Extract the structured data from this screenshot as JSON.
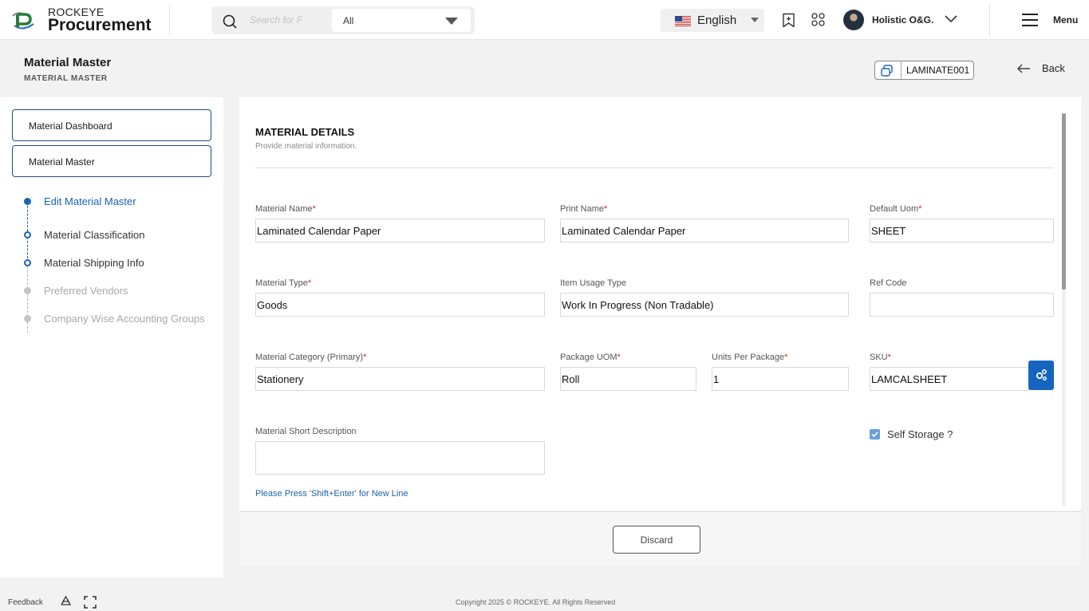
{
  "header": {
    "brand_top": "ROCKEYE",
    "brand_main": "Procurement",
    "search_placeholder": "Search for F",
    "scope_value": "All",
    "language": "English",
    "user_name": "Holistic O&G.",
    "menu_label": "Menu"
  },
  "page": {
    "title": "Material Master",
    "subtitle": "MATERIAL MASTER",
    "code": "LAMINATE001",
    "back_label": "Back"
  },
  "sidebar": {
    "buttons": [
      "Material Dashboard",
      "Material Master"
    ],
    "steps": [
      {
        "label": "Edit Material Master",
        "state": "active"
      },
      {
        "label": "Material Classification",
        "state": "done"
      },
      {
        "label": "Material Shipping Info",
        "state": "done"
      },
      {
        "label": "Preferred Vendors",
        "state": "pending"
      },
      {
        "label": "Company Wise Accounting Groups",
        "state": "pending"
      }
    ]
  },
  "form": {
    "section_title": "MATERIAL DETAILS",
    "section_subtitle": "Provide material information.",
    "required_mark": "*",
    "fields": {
      "material_name": {
        "label": "Material Name",
        "value": "Laminated Calendar Paper",
        "required": true
      },
      "print_name": {
        "label": "Print Name",
        "value": "Laminated Calendar Paper",
        "required": true
      },
      "default_uom": {
        "label": "Default Uom",
        "value": "SHEET",
        "required": true
      },
      "material_type": {
        "label": "Material Type",
        "value": "Goods",
        "required": true
      },
      "item_usage_type": {
        "label": "Item Usage Type",
        "value": "Work In Progress (Non Tradable)",
        "required": false
      },
      "ref_code": {
        "label": "Ref Code",
        "value": "",
        "required": false
      },
      "material_category": {
        "label": "Material Category (Primary)",
        "value": "Stationery",
        "required": true
      },
      "package_uom": {
        "label": "Package UOM",
        "value": "Roll",
        "required": true
      },
      "units_per_package": {
        "label": "Units Per Package",
        "value": "1",
        "required": true
      },
      "sku": {
        "label": "SKU",
        "value": "LAMCALSHEET",
        "required": true
      },
      "short_description": {
        "label": "Material Short Description",
        "value": "",
        "required": false
      }
    },
    "self_storage_label": "Self Storage ?",
    "self_storage_checked": true,
    "hint": "Please Press 'Shift+Enter' for New Line"
  },
  "actions": {
    "discard_label": "Discard"
  },
  "footer": {
    "feedback": "Feedback",
    "copyright": "Copyright 2025 © ROCKEYE. All Rights Reserved"
  },
  "colors": {
    "accent": "#1865b4",
    "sku_button": "#1565c0",
    "required": "#d0202a",
    "sidebar_border": "#1e4f7b"
  }
}
